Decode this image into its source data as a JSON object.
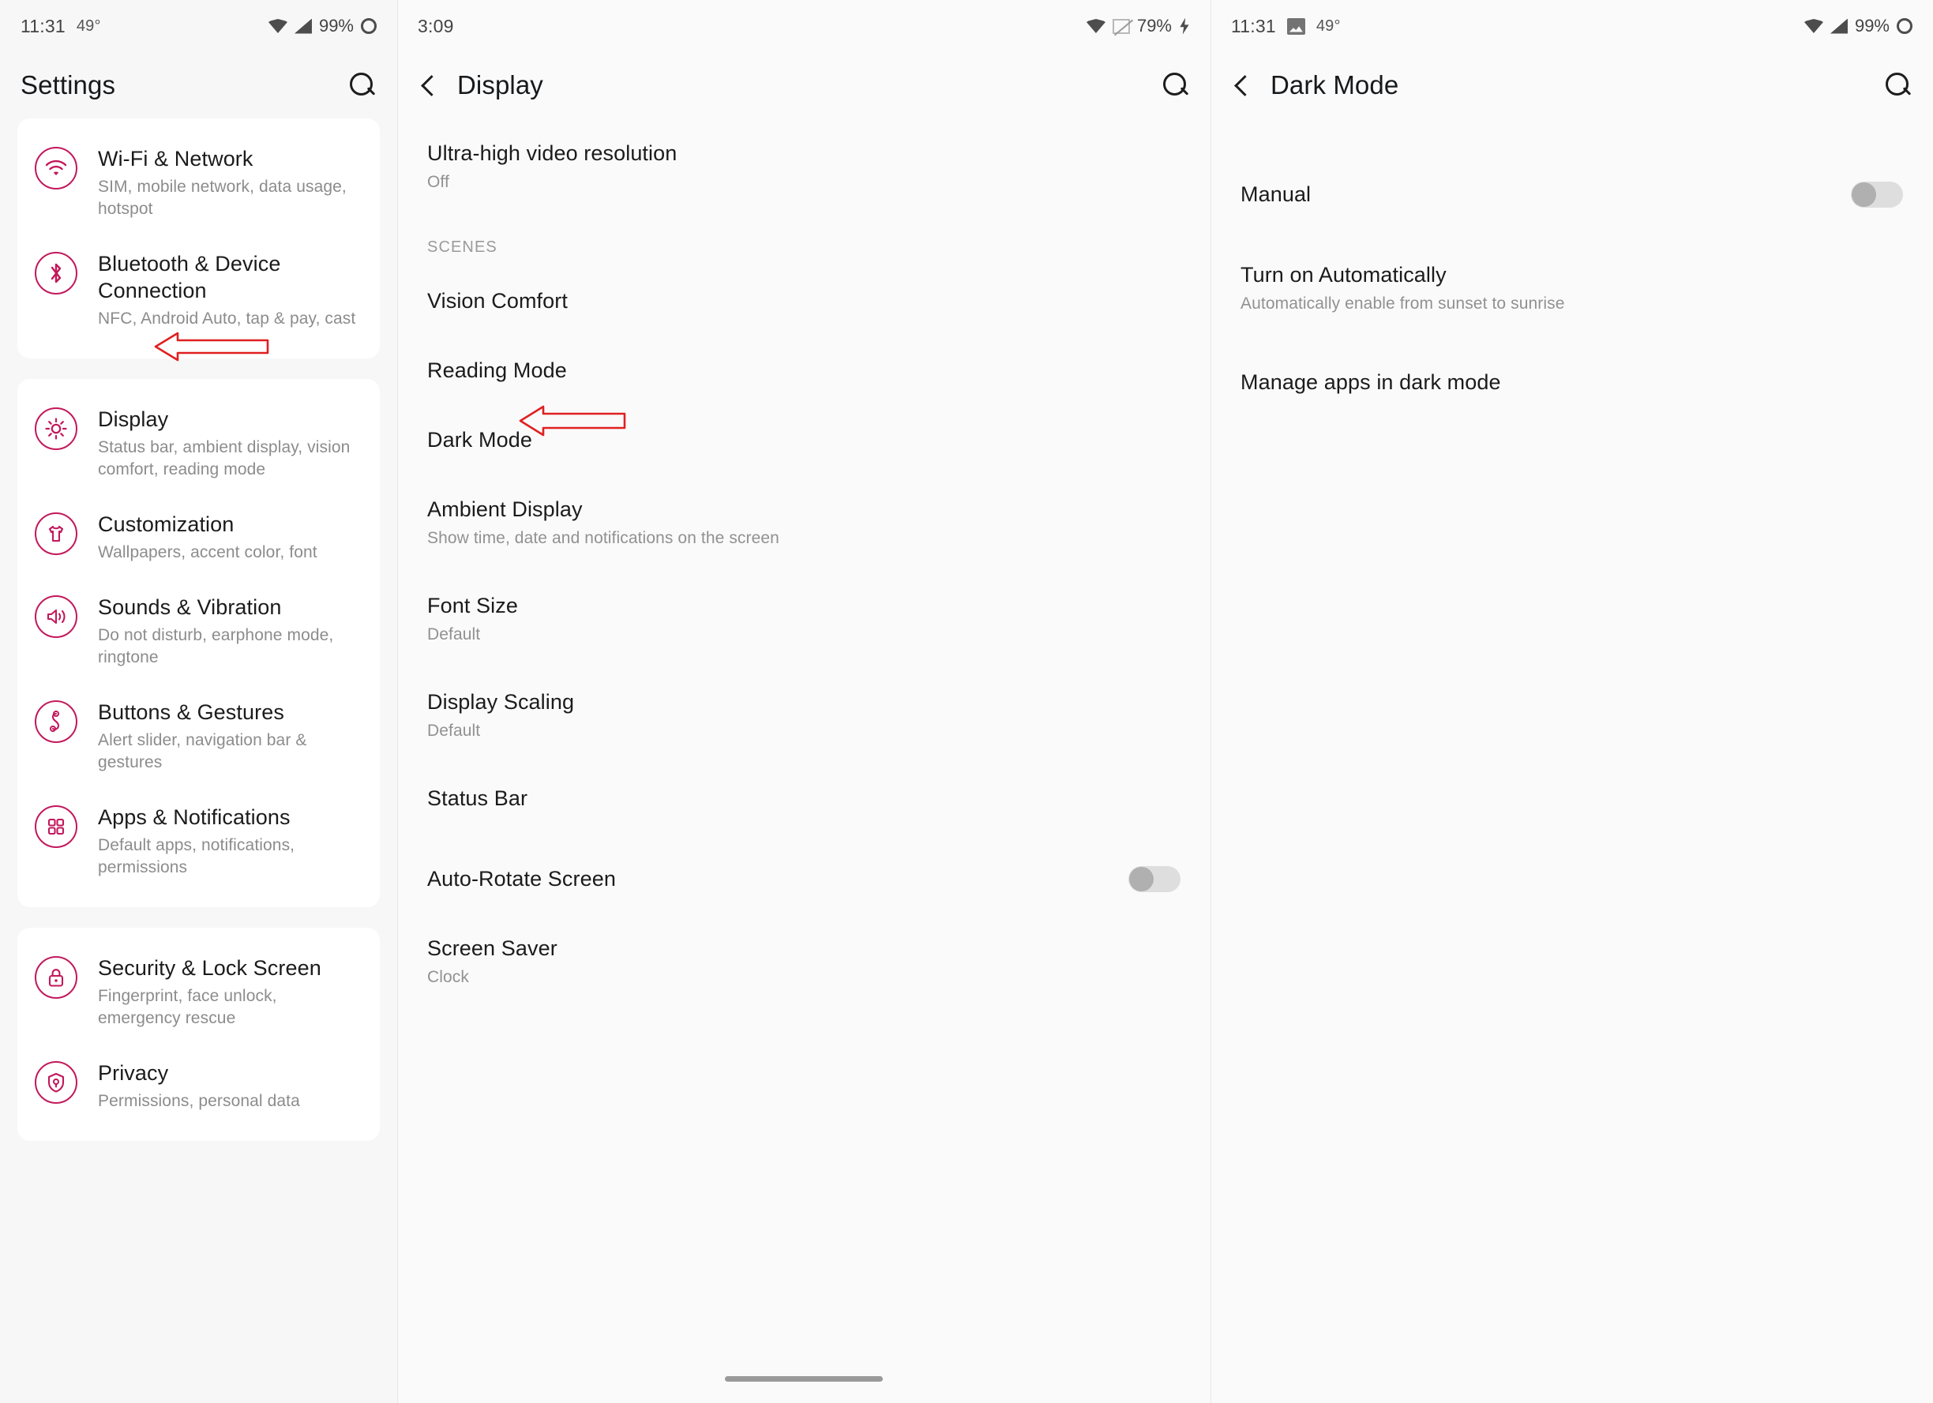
{
  "panels": {
    "settings": {
      "status": {
        "time": "11:31",
        "temp": "49°",
        "battery": "99%",
        "icons": [
          "wifi-icon",
          "signal-icon",
          "battery-ring-icon"
        ]
      },
      "appbar": {
        "title": "Settings",
        "search": "search-icon"
      },
      "groups": [
        {
          "items": [
            {
              "icon": "wifi-icon",
              "title": "Wi-Fi & Network",
              "subtitle": "SIM, mobile network, data usage, hotspot"
            },
            {
              "icon": "bluetooth-icon",
              "title": "Bluetooth & Device Connection",
              "subtitle": "NFC, Android Auto, tap & pay, cast"
            }
          ]
        },
        {
          "items": [
            {
              "icon": "brightness-icon",
              "title": "Display",
              "subtitle": "Status bar, ambient display, vision comfort, reading mode"
            },
            {
              "icon": "tshirt-icon",
              "title": "Customization",
              "subtitle": "Wallpapers, accent color, font"
            },
            {
              "icon": "volume-icon",
              "title": "Sounds & Vibration",
              "subtitle": "Do not disturb, earphone mode, ringtone"
            },
            {
              "icon": "gesture-icon",
              "title": "Buttons & Gestures",
              "subtitle": "Alert slider, navigation bar & gestures"
            },
            {
              "icon": "apps-grid-icon",
              "title": "Apps & Notifications",
              "subtitle": "Default apps, notifications, permissions"
            }
          ]
        },
        {
          "items": [
            {
              "icon": "lock-icon",
              "title": "Security & Lock Screen",
              "subtitle": "Fingerprint, face unlock, emergency rescue"
            },
            {
              "icon": "privacy-shield-icon",
              "title": "Privacy",
              "subtitle": "Permissions, personal data"
            }
          ]
        }
      ]
    },
    "display": {
      "status": {
        "time": "3:09",
        "battery": "79%",
        "icons": [
          "wifi-icon",
          "signal-off-icon",
          "charging-bolt-icon"
        ]
      },
      "appbar": {
        "back": "back-icon",
        "title": "Display",
        "search": "search-icon"
      },
      "items": [
        {
          "title": "Ultra-high video resolution",
          "subtitle": "Off"
        },
        {
          "section": "SCENES"
        },
        {
          "title": "Vision Comfort",
          "subtitle": ""
        },
        {
          "title": "Reading Mode",
          "subtitle": ""
        },
        {
          "title": "Dark Mode",
          "subtitle": ""
        },
        {
          "title": "Ambient Display",
          "subtitle": "Show time, date and notifications on the screen"
        },
        {
          "title": "Font Size",
          "subtitle": "Default"
        },
        {
          "title": "Display Scaling",
          "subtitle": "Default"
        },
        {
          "title": "Status Bar",
          "subtitle": ""
        },
        {
          "title": "Auto-Rotate Screen",
          "subtitle": "",
          "toggle": "off"
        },
        {
          "title": "Screen Saver",
          "subtitle": "Clock"
        }
      ]
    },
    "darkmode": {
      "status": {
        "time": "11:31",
        "temp": "49°",
        "battery": "99%",
        "icons": [
          "photo-icon",
          "wifi-icon",
          "signal-icon",
          "battery-ring-icon"
        ]
      },
      "appbar": {
        "back": "back-icon",
        "title": "Dark Mode",
        "search": "search-icon"
      },
      "items": [
        {
          "title": "Manual",
          "subtitle": "",
          "toggle": "off"
        },
        {
          "title": "Turn on Automatically",
          "subtitle": "Automatically enable from sunset to sunrise"
        },
        {
          "title": "Manage apps in dark mode",
          "subtitle": ""
        }
      ]
    }
  },
  "annotations": {
    "arrow_color": "#e02020",
    "arrows": [
      {
        "name": "display-row-arrow",
        "points_to": "Display"
      },
      {
        "name": "dark-mode-row-arrow",
        "points_to": "Dark Mode"
      }
    ]
  },
  "colors": {
    "accent": "#c2185b",
    "annotation": "#e02020",
    "card_bg": "#ffffff",
    "panel_bg": "#fafafa",
    "title_text": "#1b1b1b",
    "subtitle_text": "#8c8c8c"
  }
}
